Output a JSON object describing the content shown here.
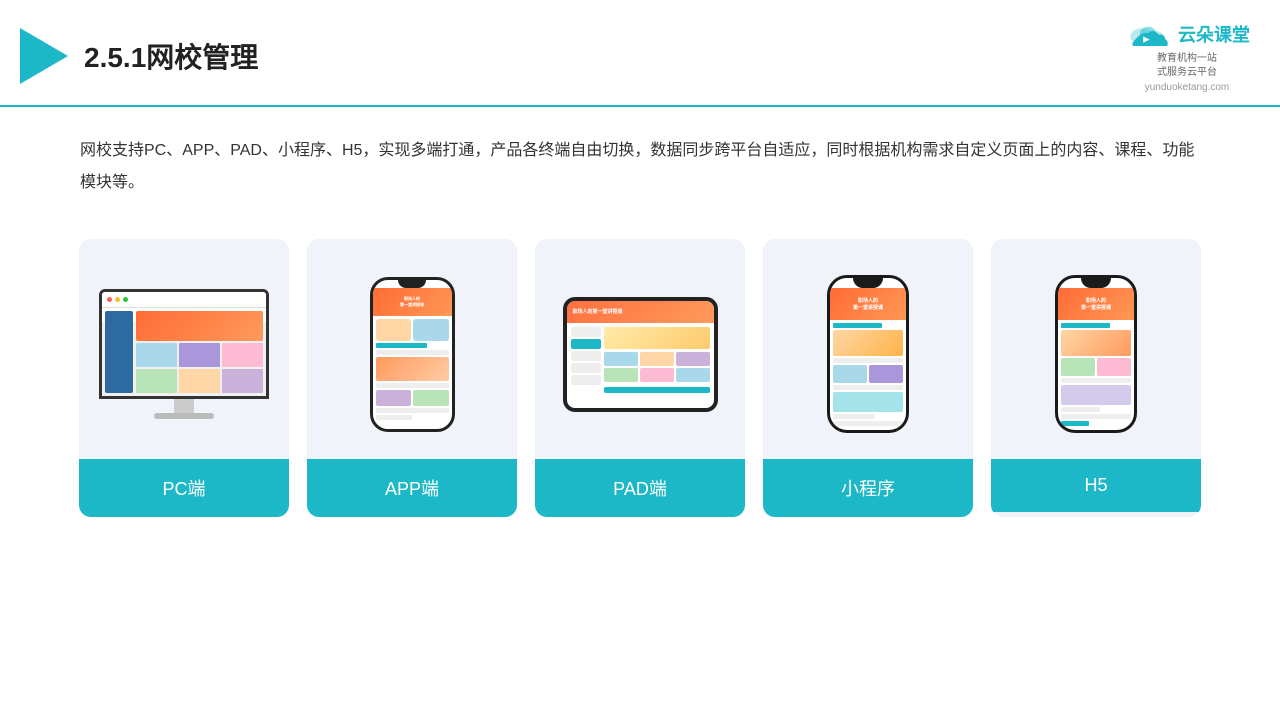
{
  "header": {
    "title": "2.5.1网校管理",
    "brand_name": "云朵课堂",
    "brand_url": "yunduoketang.com",
    "brand_tagline": "教育机构一站\n式服务云平台"
  },
  "description": "网校支持PC、APP、PAD、小程序、H5，实现多端打通，产品各终端自由切换，数据同步跨平台自适应，同时根据机构需求自定义页面上的内容、课程、功能模块等。",
  "cards": [
    {
      "id": "pc",
      "label": "PC端"
    },
    {
      "id": "app",
      "label": "APP端"
    },
    {
      "id": "pad",
      "label": "PAD端"
    },
    {
      "id": "miniprogram",
      "label": "小程序"
    },
    {
      "id": "h5",
      "label": "H5"
    }
  ]
}
